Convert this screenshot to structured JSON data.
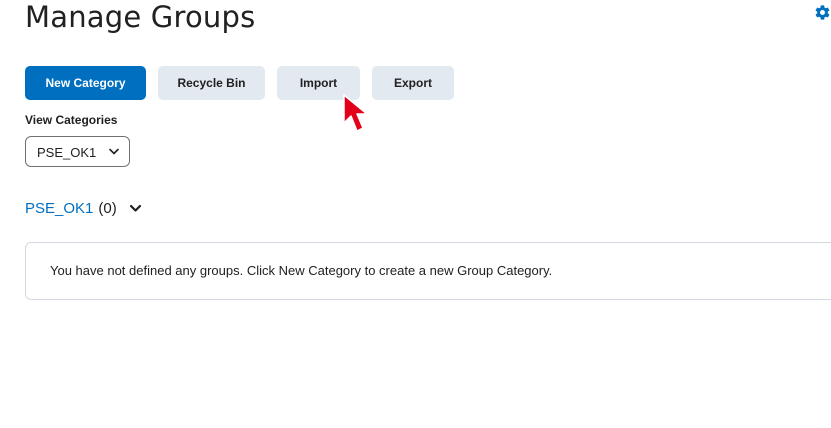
{
  "page": {
    "title": "Manage Groups"
  },
  "toolbar": {
    "new_category_label": "New Category",
    "recycle_bin_label": "Recycle Bin",
    "import_label": "Import",
    "export_label": "Export"
  },
  "view_categories": {
    "label": "View Categories",
    "selected": "PSE_OK1"
  },
  "category": {
    "name": "PSE_OK1",
    "count": "(0)"
  },
  "empty_state": {
    "message": "You have not defined any groups. Click New Category to create a new Group Category."
  },
  "colors": {
    "primary": "#006fbf",
    "secondary_button": "#e3e9f1",
    "text": "#202122",
    "cursor": "#e3001b"
  },
  "icons": {
    "settings": "gear-icon",
    "select_chevron": "chevron-down-icon",
    "category_chevron": "chevron-down-icon",
    "pointer": "cursor-pointer-icon"
  }
}
